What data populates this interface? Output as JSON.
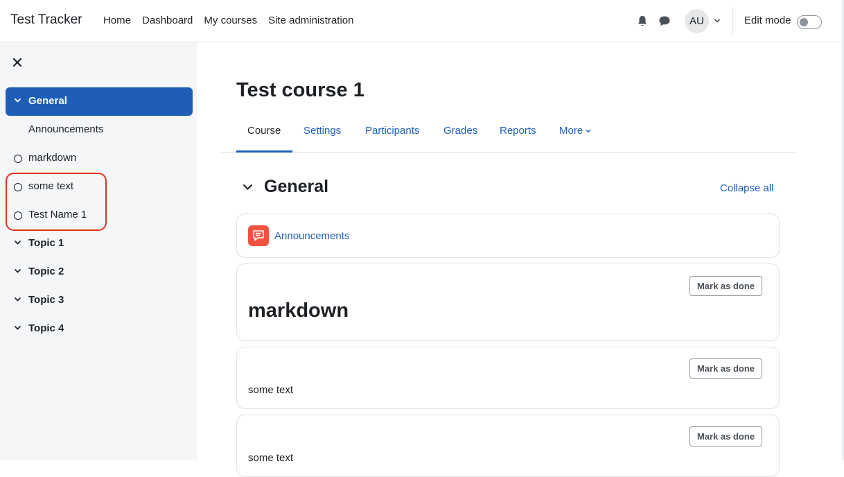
{
  "navbar": {
    "brand": "Test Tracker",
    "links": [
      "Home",
      "Dashboard",
      "My courses",
      "Site administration"
    ],
    "avatar_initials": "AU",
    "edit_mode_label": "Edit mode"
  },
  "drawer": {
    "items": [
      {
        "label": "General",
        "kind": "section",
        "icon": "chevron-down-icon",
        "active": true
      },
      {
        "label": "Announcements",
        "kind": "activity",
        "icon": ""
      },
      {
        "label": "markdown",
        "kind": "activity",
        "icon": "circle-icon"
      },
      {
        "label": "some text",
        "kind": "activity",
        "icon": "circle-icon"
      },
      {
        "label": "Test Name 1",
        "kind": "activity",
        "icon": "circle-icon"
      },
      {
        "label": "Topic 1",
        "kind": "section",
        "icon": "chevron-down-icon"
      },
      {
        "label": "Topic 2",
        "kind": "section",
        "icon": "chevron-down-icon"
      },
      {
        "label": "Topic 3",
        "kind": "section",
        "icon": "chevron-down-icon"
      },
      {
        "label": "Topic 4",
        "kind": "section",
        "icon": "chevron-down-icon"
      }
    ]
  },
  "main": {
    "title": "Test course 1",
    "tabs": [
      "Course",
      "Settings",
      "Participants",
      "Grades",
      "Reports",
      "More"
    ],
    "active_tab": "Course",
    "section_title": "General",
    "collapse_all": "Collapse all",
    "activities": {
      "announcements": "Announcements",
      "mark_done": "Mark as done",
      "markdown_heading": "markdown",
      "some_text": "some text",
      "some_text_2": "some text"
    }
  },
  "colors": {
    "primary": "#1e5eb8",
    "highlight": "#e0331f",
    "forum_icon": "#f0533f",
    "drawer_bg": "#f5f6f8"
  }
}
